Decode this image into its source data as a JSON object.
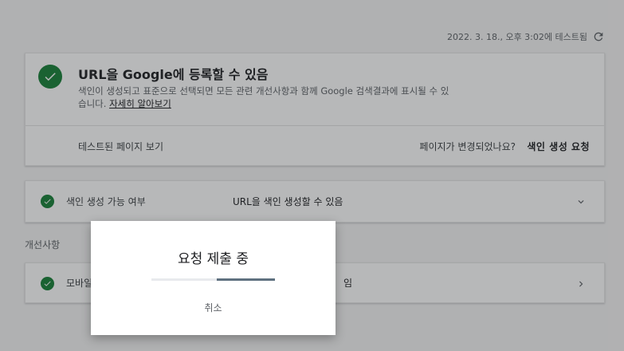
{
  "test_meta": {
    "text": "2022. 3. 18., 오후 3:02에 테스트됨",
    "icon": "refresh-icon"
  },
  "main_card": {
    "title": "URL을 Google에 등록할 수 있음",
    "description": "색인이 생성되고 표준으로 선택되면 모든 관련 개선사항과 함께 Google 검색결과에 표시될 수 있습니다.",
    "learn_more": "자세히 알아보기",
    "view_tested_page": "테스트된 페이지 보기",
    "page_changed_question": "페이지가 변경되었나요?",
    "request_indexing": "색인 생성 요청"
  },
  "indexing_row": {
    "label": "색인 생성 가능 여부",
    "value": "URL을 색인 생성할 수 있음"
  },
  "enhancements": {
    "title": "개선사항",
    "rows": [
      {
        "label": "모바일",
        "value": "임"
      }
    ]
  },
  "dialog": {
    "title": "요청 제출 중",
    "cancel": "취소",
    "progress": {
      "start": 0.53,
      "end": 1.0
    }
  },
  "colors": {
    "success": "#188038",
    "progress": "#5f7180",
    "scrim": "rgba(32,33,36,0.32)"
  }
}
